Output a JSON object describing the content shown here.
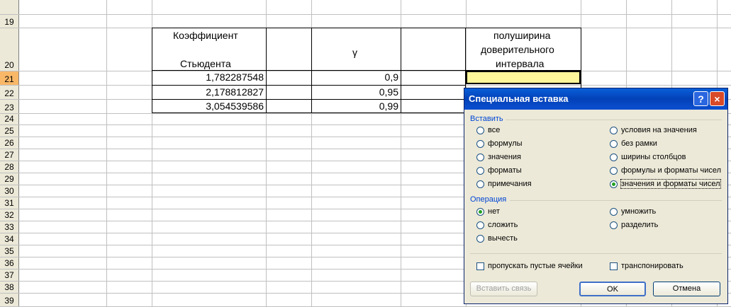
{
  "rows": [
    "19",
    "20",
    "21",
    "22",
    "23",
    "24",
    "25",
    "26",
    "27",
    "28",
    "29",
    "30",
    "31",
    "32",
    "33",
    "34",
    "35",
    "36",
    "37",
    "38",
    "39"
  ],
  "active_row": "21",
  "table": {
    "header_col1_line1": "Коэффициент",
    "header_col1_line2": "Стьюдента",
    "header_col2": "γ",
    "header_col4_line1": "полуширина",
    "header_col4_line2": "доверительного",
    "header_col4_line3": "интервала",
    "rows": [
      {
        "coef": "1,782287548",
        "gamma": "0,9"
      },
      {
        "coef": "2,178812827",
        "gamma": "0,95"
      },
      {
        "coef": "3,054539586",
        "gamma": "0,99"
      }
    ]
  },
  "dialog": {
    "title": "Специальная вставка",
    "help": "?",
    "close": "×",
    "paste_group": "Вставить",
    "paste_left": [
      "все",
      "формулы",
      "значения",
      "форматы",
      "примечания"
    ],
    "paste_right": [
      "условия на значения",
      "без рамки",
      "ширины столбцов",
      "формулы и форматы чисел",
      "значения и форматы чисел"
    ],
    "paste_selected": "значения и форматы чисел",
    "op_group": "Операция",
    "op_left": [
      "нет",
      "сложить",
      "вычесть"
    ],
    "op_right": [
      "умножить",
      "разделить"
    ],
    "op_selected": "нет",
    "skip_blanks": "пропускать пустые ячейки",
    "transpose": "транспонировать",
    "paste_link": "Вставить связь",
    "ok": "OK",
    "cancel": "Отмена"
  }
}
